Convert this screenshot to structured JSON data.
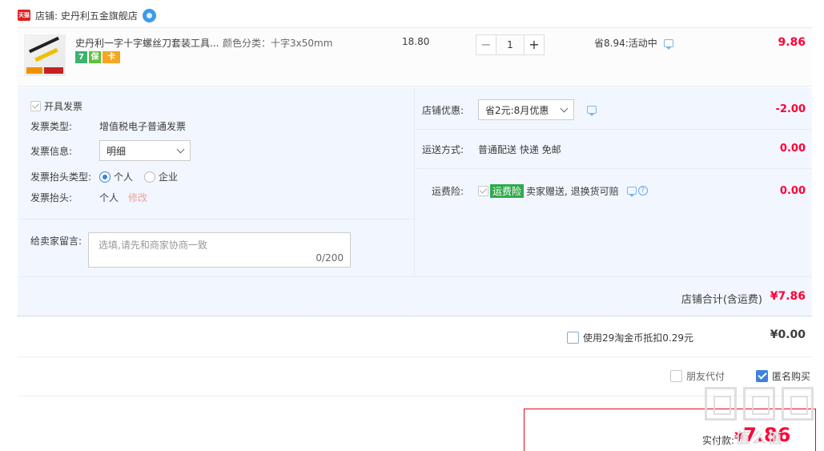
{
  "shop": {
    "badge": "天猫",
    "label": "店铺: 史丹利五金旗舰店"
  },
  "item": {
    "title": "史丹利一字十字螺丝刀套装工具...",
    "sku": "颜色分类：十字3x50mm",
    "unit_price": "18.80",
    "quantity": "1",
    "minus": "−",
    "plus": "+",
    "saving": "省8.94:活动中",
    "total": "9.86",
    "service_icons": [
      "7",
      "保",
      "卡"
    ]
  },
  "invoice": {
    "checkbox_label": "开具发票",
    "type_label": "发票类型:",
    "type_value": "增值税电子普通发票",
    "info_label": "发票信息:",
    "info_value": "明细",
    "title_type_label": "发票抬头类型:",
    "title_type_options": [
      "个人",
      "企业"
    ],
    "title_label": "发票抬头:",
    "title_value": "个人",
    "edit_link": "修改"
  },
  "message": {
    "label": "给卖家留言:",
    "placeholder": "选填,请先和商家协商一致",
    "count": "0/200"
  },
  "shop_discount": {
    "label": "店铺优惠:",
    "selected": "省2元:8月优惠",
    "amount": "-2.00"
  },
  "shipping": {
    "label": "运送方式:",
    "value": "普通配送 快递 免邮",
    "amount": "0.00"
  },
  "insurance": {
    "label": "运费险:",
    "tag": "运费险",
    "desc": "卖家赠送, 退换货可赔",
    "amount": "0.00"
  },
  "shop_total": {
    "label": "店铺合计(含运费)",
    "value": "¥7.86"
  },
  "coins": {
    "label": "使用29淘金币抵扣0.29元",
    "value": "¥0.00"
  },
  "payment": {
    "friend_pay": "朋友代付",
    "anonymous": "匿名购买"
  },
  "final": {
    "label": "实付款:",
    "currency": "¥",
    "value": "7.86"
  },
  "watermark": {
    "text": "值么值"
  }
}
